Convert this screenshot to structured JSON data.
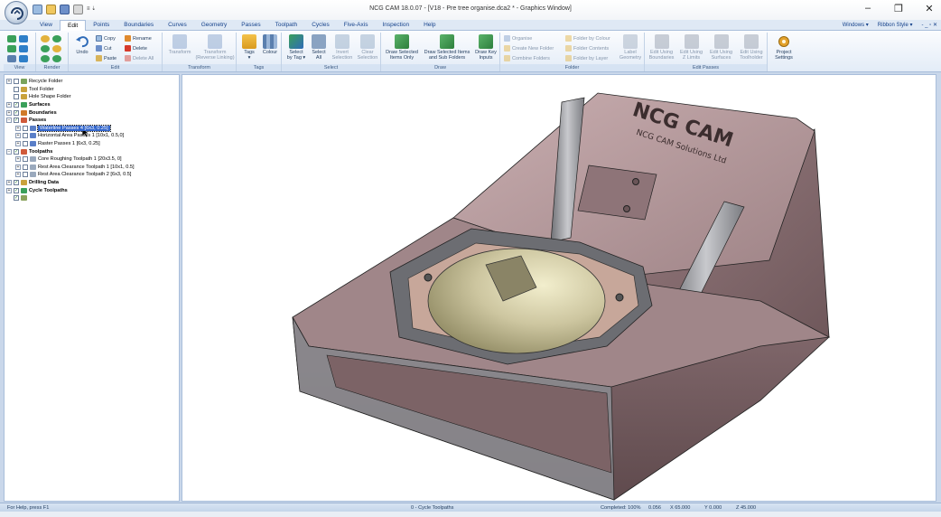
{
  "window": {
    "title": "NCG CAM 18.0.07 - [V18 - Pre tree organise.dca2 * - Graphics Window]",
    "controls": {
      "minimize": "–",
      "restore": "❐",
      "close": "✕"
    }
  },
  "qat_extra": "≡ ⇣",
  "tabs": [
    "View",
    "Edit",
    "Points",
    "Boundaries",
    "Curves",
    "Geometry",
    "Passes",
    "Toolpath",
    "Cycles",
    "Five-Axis",
    "Inspection",
    "Help"
  ],
  "active_tab": "Edit",
  "tab_right": {
    "windows": "Windows ▾",
    "ribbon_style": "Ribbon Style ▾",
    "extras": "- _ ▫ ✕"
  },
  "ribbon": {
    "groups": {
      "view": "View",
      "render": "Render",
      "edit": "Edit",
      "transform": "Transform",
      "tags": "Tags",
      "select": "Select",
      "draw": "Draw",
      "folder": "Folder",
      "edit_passes": "Edit Passes"
    },
    "edit": {
      "undo": "Undo",
      "copy": "Copy",
      "cut": "Cut",
      "paste": "Paste",
      "rename": "Rename",
      "delete": "Delete",
      "delete_all": "Delete All"
    },
    "transform": {
      "transform": "Transform",
      "transform_reverse": "Transform\n(Reverse Linking)"
    },
    "tags": {
      "tags": "Tags\n▾",
      "colour": "Colour"
    },
    "select": {
      "select_by_tag": "Select\nby Tag ▾",
      "select_all": "Select\nAll",
      "invert_selection": "Invert\nSelection",
      "clear_selection": "Clear\nSelection"
    },
    "draw": {
      "draw_selected": "Draw Selected\nItems Only",
      "draw_selected_sub": "Draw Selected Items\nand Sub Folders",
      "draw_key_inputs": "Draw Key\nInputs"
    },
    "folder": {
      "organise": "Organise",
      "create_new_folder": "Create New Folder",
      "combine_folders": "Combine Folders",
      "folder_by_colour": "Folder by Colour",
      "folder_contents": "Folder Contents",
      "folder_by_layer": "Folder by Layer",
      "label_geometry": "Label\nGeometry"
    },
    "edit_passes": {
      "edit_boundaries": "Edit Using\nBoundaries",
      "edit_z_limits": "Edit Using\nZ Limits",
      "edit_surfaces": "Edit Using\nSurfaces",
      "edit_toolholder": "Edit Using\nToolholder"
    },
    "project_settings": "Project\nSettings"
  },
  "tree": [
    {
      "label": "Recycle Folder",
      "expander": "+",
      "checkbox": false,
      "icon": "recycle-folder",
      "bold": false,
      "indent": 0
    },
    {
      "label": "Tool Folder",
      "expander": "",
      "checkbox": false,
      "icon": "tool-folder",
      "bold": false,
      "indent": 0
    },
    {
      "label": "Hole Shape Folder",
      "expander": "",
      "checkbox": false,
      "icon": "hole-folder",
      "bold": false,
      "indent": 0
    },
    {
      "label": "Surfaces",
      "expander": "+",
      "checkbox": true,
      "icon": "surfaces",
      "bold": true,
      "indent": 0
    },
    {
      "label": "Boundaries",
      "expander": "+",
      "checkbox": true,
      "icon": "boundaries",
      "bold": true,
      "indent": 0
    },
    {
      "label": "Passes",
      "expander": "−",
      "checkbox": true,
      "icon": "passes",
      "bold": true,
      "indent": 0
    },
    {
      "label": "Waterline Passes 4 [6x3, 0.25]",
      "expander": "+",
      "checkbox": false,
      "icon": "pass",
      "bold": false,
      "indent": 1,
      "selected": true
    },
    {
      "label": "Horizontal Area Passes 1 [10x1, 0.5,0]",
      "expander": "+",
      "checkbox": false,
      "icon": "pass",
      "bold": false,
      "indent": 1
    },
    {
      "label": "Raster Passes 1 [6x3, 0.25]",
      "expander": "+",
      "checkbox": false,
      "icon": "pass",
      "bold": false,
      "indent": 1
    },
    {
      "label": "Toolpaths",
      "expander": "−",
      "checkbox": true,
      "icon": "toolpaths",
      "bold": true,
      "indent": 0
    },
    {
      "label": "Core Roughing Toolpath 1 [20x3.5, 0]",
      "expander": "+",
      "checkbox": false,
      "icon": "toolpath",
      "bold": false,
      "indent": 1
    },
    {
      "label": "Rest Area Clearance Toolpath 1 [10x1, 0.5]",
      "expander": "+",
      "checkbox": false,
      "icon": "toolpath",
      "bold": false,
      "indent": 1
    },
    {
      "label": "Rest Area Clearance Toolpath 2 [6x3, 0.5]",
      "expander": "+",
      "checkbox": false,
      "icon": "toolpath",
      "bold": false,
      "indent": 1
    },
    {
      "label": "Drilling Data",
      "expander": "+",
      "checkbox": true,
      "icon": "drilling",
      "bold": true,
      "indent": 0
    },
    {
      "label": "Cycle Toolpaths",
      "expander": "+",
      "checkbox": true,
      "icon": "cycle",
      "bold": true,
      "indent": 0
    },
    {
      "label": "",
      "expander": "",
      "checkbox": true,
      "icon": "misc",
      "bold": false,
      "indent": 0
    }
  ],
  "model": {
    "engraving_logo": "NCG CAM",
    "engraving_text": "NCG CAM Solutions Ltd"
  },
  "status": {
    "help": "For Help, press F1",
    "center": "0 - Cycle Toolpaths",
    "completed": "Completed: 100%",
    "value": "0.056",
    "x": "X 65.000",
    "y": "Y 0.000",
    "z": "Z 45.000"
  },
  "colors": {
    "ribbon_bg": "#e3ecf7",
    "selection": "#3366cc",
    "model_body": "#8a6f72",
    "model_dome": "#c9c29e",
    "model_steel": "#a8a9ad"
  }
}
